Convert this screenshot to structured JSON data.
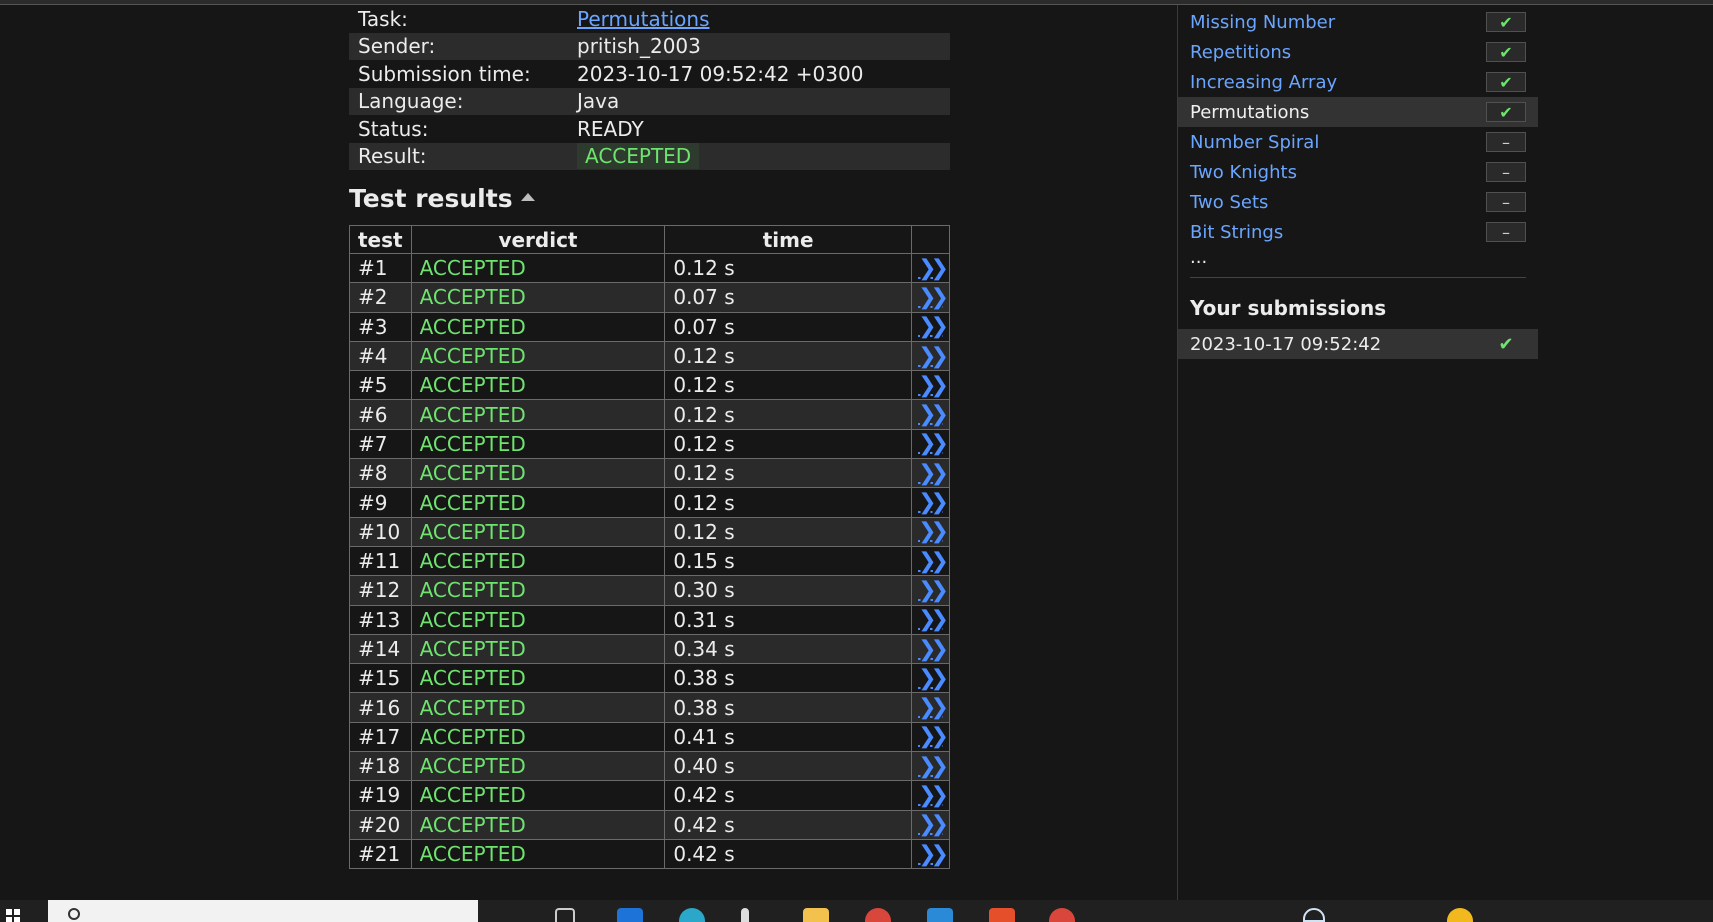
{
  "submission": {
    "task_label": "Task:",
    "task_value": "Permutations",
    "sender_label": "Sender:",
    "sender_value": "pritish_2003",
    "time_label": "Submission time:",
    "time_value": "2023-10-17 09:52:42 +0300",
    "language_label": "Language:",
    "language_value": "Java",
    "status_label": "Status:",
    "status_value": "READY",
    "result_label": "Result:",
    "result_value": "ACCEPTED"
  },
  "tests": {
    "heading": "Test results",
    "columns": [
      "test",
      "verdict",
      "time",
      ""
    ],
    "rows": [
      {
        "test": "#1",
        "verdict": "ACCEPTED",
        "time": "0.12 s"
      },
      {
        "test": "#2",
        "verdict": "ACCEPTED",
        "time": "0.07 s"
      },
      {
        "test": "#3",
        "verdict": "ACCEPTED",
        "time": "0.07 s"
      },
      {
        "test": "#4",
        "verdict": "ACCEPTED",
        "time": "0.12 s"
      },
      {
        "test": "#5",
        "verdict": "ACCEPTED",
        "time": "0.12 s"
      },
      {
        "test": "#6",
        "verdict": "ACCEPTED",
        "time": "0.12 s"
      },
      {
        "test": "#7",
        "verdict": "ACCEPTED",
        "time": "0.12 s"
      },
      {
        "test": "#8",
        "verdict": "ACCEPTED",
        "time": "0.12 s"
      },
      {
        "test": "#9",
        "verdict": "ACCEPTED",
        "time": "0.12 s"
      },
      {
        "test": "#10",
        "verdict": "ACCEPTED",
        "time": "0.12 s"
      },
      {
        "test": "#11",
        "verdict": "ACCEPTED",
        "time": "0.15 s"
      },
      {
        "test": "#12",
        "verdict": "ACCEPTED",
        "time": "0.30 s"
      },
      {
        "test": "#13",
        "verdict": "ACCEPTED",
        "time": "0.31 s"
      },
      {
        "test": "#14",
        "verdict": "ACCEPTED",
        "time": "0.34 s"
      },
      {
        "test": "#15",
        "verdict": "ACCEPTED",
        "time": "0.38 s"
      },
      {
        "test": "#16",
        "verdict": "ACCEPTED",
        "time": "0.38 s"
      },
      {
        "test": "#17",
        "verdict": "ACCEPTED",
        "time": "0.41 s"
      },
      {
        "test": "#18",
        "verdict": "ACCEPTED",
        "time": "0.40 s"
      },
      {
        "test": "#19",
        "verdict": "ACCEPTED",
        "time": "0.42 s"
      },
      {
        "test": "#20",
        "verdict": "ACCEPTED",
        "time": "0.42 s"
      },
      {
        "test": "#21",
        "verdict": "ACCEPTED",
        "time": "0.42 s"
      }
    ],
    "details_icon": "double-chevron-right-icon"
  },
  "sidebar": {
    "tasks": [
      {
        "name": "Missing Number",
        "solved": true,
        "current": false
      },
      {
        "name": "Repetitions",
        "solved": true,
        "current": false
      },
      {
        "name": "Increasing Array",
        "solved": true,
        "current": false
      },
      {
        "name": "Permutations",
        "solved": true,
        "current": true
      },
      {
        "name": "Number Spiral",
        "solved": false,
        "current": false
      },
      {
        "name": "Two Knights",
        "solved": false,
        "current": false
      },
      {
        "name": "Two Sets",
        "solved": false,
        "current": false
      },
      {
        "name": "Bit Strings",
        "solved": false,
        "current": false
      }
    ],
    "more": "...",
    "submissions_heading": "Your submissions",
    "submissions": [
      {
        "time": "2023-10-17 09:52:42",
        "accepted": true
      }
    ]
  },
  "colors": {
    "accepted": "#6ee36e",
    "link": "#6aa6ff",
    "background": "#161616"
  }
}
